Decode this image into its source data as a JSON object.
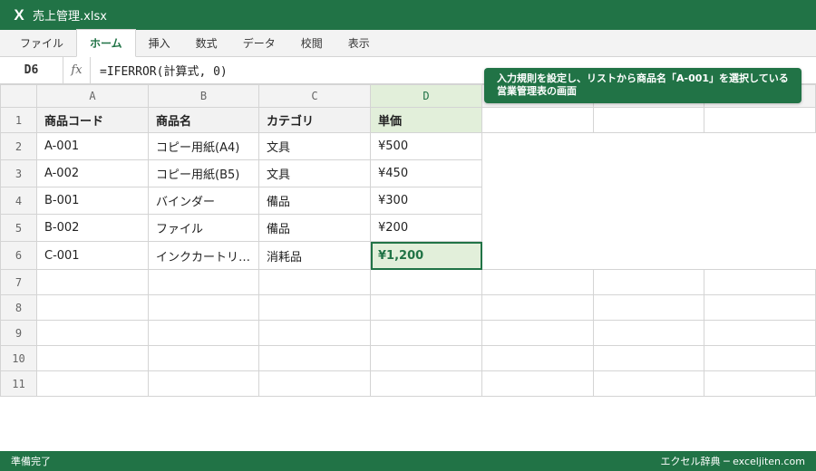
{
  "window": {
    "logo": "X",
    "title": "売上管理.xlsx"
  },
  "ribbon": {
    "tabs": [
      "ファイル",
      "ホーム",
      "挿入",
      "数式",
      "データ",
      "校閲",
      "表示"
    ],
    "active_tab": "ホーム"
  },
  "formula_bar": {
    "cell_ref": "D6",
    "fx_label": "fx",
    "formula": "=IFERROR(計算式, 0)"
  },
  "sheet": {
    "columns": [
      "A",
      "B",
      "C",
      "D"
    ],
    "selected_column": "D",
    "rows": [
      "1",
      "2",
      "3",
      "4",
      "5",
      "6",
      "7",
      "8",
      "9",
      "10",
      "11"
    ],
    "header": [
      "商品コード",
      "商品名",
      "カテゴリ",
      "単価"
    ],
    "data": [
      [
        "A-001",
        "コピー用紙(A4)",
        "文具",
        "¥500"
      ],
      [
        "A-002",
        "コピー用紙(B5)",
        "文具",
        "¥450"
      ],
      [
        "B-001",
        "バインダー",
        "備品",
        "¥300"
      ],
      [
        "B-002",
        "ファイル",
        "備品",
        "¥200"
      ],
      [
        "C-001",
        "インクカートリ…",
        "消耗品",
        "¥1,200"
      ]
    ],
    "active_cell": "D6"
  },
  "callout": {
    "text": "入力規則を設定し、リストから商品名「A-001」を選択している営業管理表の画面"
  },
  "status": {
    "left": "準備完了",
    "right": "エクセル辞典 ─ exceljiten.com"
  },
  "colors": {
    "brand": "#217346",
    "selected_fill": "#e2efda",
    "grid_line": "#d4d4d4"
  }
}
